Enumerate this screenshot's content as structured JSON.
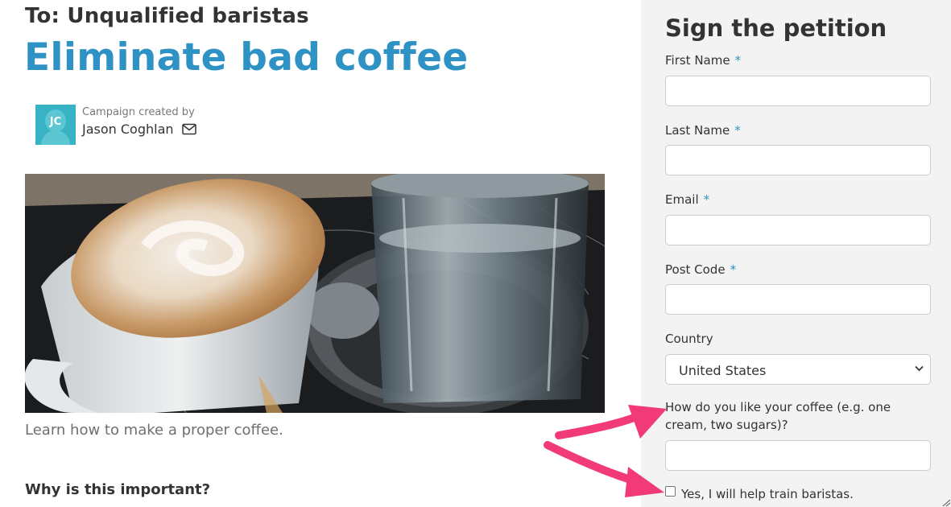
{
  "petition": {
    "to_line": "To: Unqualified baristas",
    "title": "Eliminate bad coffee",
    "creator": {
      "label": "Campaign created by",
      "name": "Jason Coghlan",
      "initials": "JC",
      "avatar_icon": "person-silhouette-icon",
      "contact_icon": "mail-icon"
    },
    "image_caption": "Learn how to make a proper coffee.",
    "why_heading": "Why is this important?"
  },
  "form": {
    "title": "Sign the petition",
    "required_marker": "*",
    "first_name_label": "First Name",
    "last_name_label": "Last Name",
    "email_label": "Email",
    "post_code_label": "Post Code",
    "country_label": "Country",
    "country_value": "United States",
    "coffee_question": "How do you like your coffee (e.g. one cream, two sugars)?",
    "train_checkbox_label": "Yes, I will help train baristas."
  },
  "annotations": {
    "arrow_color": "#f23a78",
    "arrow_count": 2
  },
  "colors": {
    "title_blue": "#2e93c4",
    "sidebar_bg": "#f3f3f3",
    "avatar_teal": "#38b3c5"
  }
}
